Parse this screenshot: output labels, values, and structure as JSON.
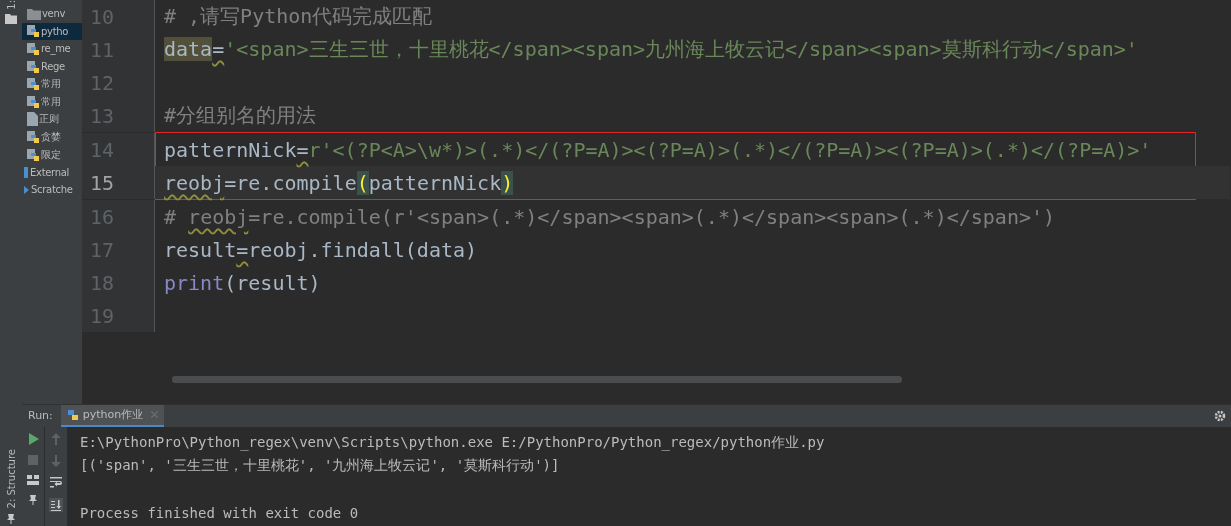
{
  "tool_strip": {
    "top_tab": "1:",
    "bottom_tab": "2: Structure"
  },
  "project_tree": {
    "items": [
      {
        "children": [
          {
            "label": "venv",
            "kind": "folder",
            "selected": false
          },
          {
            "label": "pytho",
            "kind": "python",
            "selected": true
          },
          {
            "label": "re_me",
            "kind": "python",
            "selected": false
          },
          {
            "label": "Rege",
            "kind": "python",
            "selected": false
          },
          {
            "label": "常用",
            "kind": "python",
            "selected": false
          },
          {
            "label": "常用",
            "kind": "python",
            "selected": false
          },
          {
            "label": "正则",
            "kind": "text",
            "selected": false
          },
          {
            "label": "贪婪",
            "kind": "python",
            "selected": false
          },
          {
            "label": "限定",
            "kind": "python",
            "selected": false
          }
        ]
      },
      {
        "label": "External",
        "kind": "library",
        "selected": false
      },
      {
        "label": "Scratche",
        "kind": "scratch",
        "selected": false
      }
    ]
  },
  "editor": {
    "lines": [
      {
        "number": "10",
        "current": false,
        "boxed": false,
        "tokens": [
          {
            "text": "# ,请写Python代码完成匹配",
            "kind": "comment"
          }
        ]
      },
      {
        "number": "11",
        "current": false,
        "boxed": false,
        "tokens": [
          {
            "text": "data",
            "kind": "usage"
          },
          {
            "text": "=",
            "kind": "warn"
          },
          {
            "text": "'<span>三生三世，十里桃花</span><span>九州海上牧云记</span><span>莫斯科行动</span>'",
            "kind": "string"
          }
        ]
      },
      {
        "number": "12",
        "current": false,
        "boxed": false
      },
      {
        "number": "13",
        "current": false,
        "boxed": false,
        "tokens": [
          {
            "text": "#分组别名的用法",
            "kind": "comment"
          }
        ]
      },
      {
        "number": "14",
        "current": false,
        "boxed": true,
        "tokens": [
          {
            "text": "patternNick",
            "kind": "plain"
          },
          {
            "text": "=",
            "kind": "warn"
          },
          {
            "text": "r'<(?P<A>\\w*)>(.*)</(?P=A)><(?P=A)>(.*)</(?P=A)><(?P=A)>(.*)</(?P=A)>'",
            "kind": "string"
          }
        ]
      },
      {
        "number": "15",
        "current": true,
        "boxed": true,
        "tokens": [
          {
            "text": "reobj",
            "kind": "warn"
          },
          {
            "text": "=re.compile",
            "kind": "plain"
          },
          {
            "text": "(",
            "kind": "brace"
          },
          {
            "text": "patternNick",
            "kind": "plain"
          },
          {
            "text": ")",
            "kind": "brace"
          }
        ]
      },
      {
        "number": "16",
        "current": false,
        "boxed": false,
        "tokens": [
          {
            "text": "# ",
            "kind": "comment"
          },
          {
            "text": "reobj",
            "kind": "comment-warn"
          },
          {
            "text": "=re.compile(r'<span>(.*)</span><span>(.*)</span><span>(.*)</span>')",
            "kind": "comment"
          }
        ]
      },
      {
        "number": "17",
        "current": false,
        "boxed": false,
        "tokens": [
          {
            "text": "result",
            "kind": "plain"
          },
          {
            "text": "=",
            "kind": "warn"
          },
          {
            "text": "reobj.findall(data)",
            "kind": "plain"
          }
        ]
      },
      {
        "number": "18",
        "current": false,
        "boxed": false,
        "tokens": [
          {
            "text": "print",
            "kind": "builtin"
          },
          {
            "text": "(result)",
            "kind": "plain"
          }
        ]
      },
      {
        "number": "19",
        "current": false,
        "boxed": false
      }
    ]
  },
  "run_panel": {
    "label": "Run:",
    "tab": {
      "title": "python作业",
      "selected": true
    },
    "output": [
      {
        "text": "E:\\PythonPro\\Python_regex\\venv\\Scripts\\python.exe E:/PythonPro/Python_regex/python作业.py",
        "kind": "command"
      },
      {
        "text": "[('span', '三生三世，十里桃花', '九州海上牧云记', '莫斯科行动')]",
        "kind": "result"
      },
      {
        "text": "Process finished with exit code 0",
        "kind": "status"
      }
    ]
  }
}
